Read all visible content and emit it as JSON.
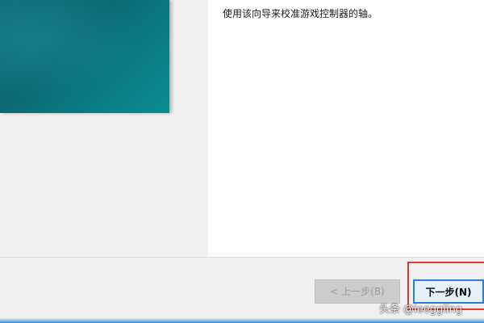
{
  "wizard": {
    "instruction": "使用该向导来校准游戏控制器的轴。"
  },
  "buttons": {
    "back_label": "< 上一步(B)",
    "next_label": "下一步(N)"
  },
  "watermark": "头条 @leeggling",
  "colors": {
    "banner_teal": "#0c6a74",
    "highlight_red": "#e53935",
    "focus_blue": "#2f80d1"
  }
}
